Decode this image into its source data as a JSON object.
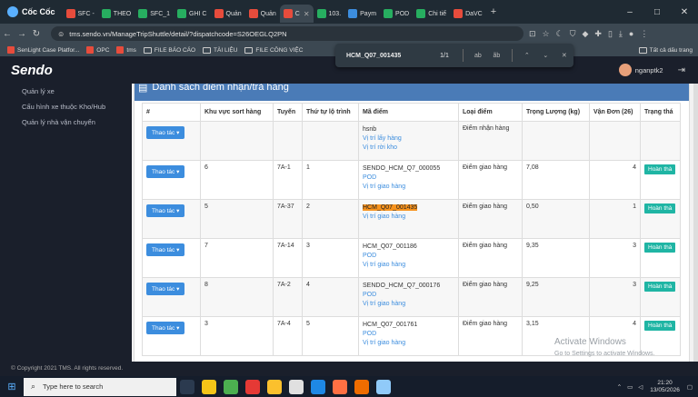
{
  "browser": {
    "brand": "Cốc Cốc",
    "tabs": [
      {
        "label": "SFC -",
        "color": "#e74c3c"
      },
      {
        "label": "THEO",
        "color": "#27ae60"
      },
      {
        "label": "SFC_1",
        "color": "#27ae60"
      },
      {
        "label": "GHI C",
        "color": "#27ae60"
      },
      {
        "label": "Quản",
        "color": "#e74c3c"
      },
      {
        "label": "Quản",
        "color": "#e74c3c"
      },
      {
        "label": "C",
        "color": "#e74c3c"
      },
      {
        "label": "103.",
        "color": "#27ae60"
      },
      {
        "label": "Paym",
        "color": "#3c8dde"
      },
      {
        "label": "POD",
        "color": "#27ae60"
      },
      {
        "label": "Chi tiế",
        "color": "#27ae60"
      },
      {
        "label": "DaVC",
        "color": "#e74c3c"
      }
    ],
    "active_tab_index": 6,
    "url": "tms.sendo.vn/ManageTripShuttle/detail/?dispatchcode=S26OEGLQ2PN",
    "bookmarks": [
      {
        "label": "SenLight Case Platfor...",
        "kind": "site",
        "color": "#e74c3c"
      },
      {
        "label": "OPC",
        "kind": "site",
        "color": "#e74c3c"
      },
      {
        "label": "tms",
        "kind": "site",
        "color": "#e74c3c"
      },
      {
        "label": "FILE BÁO CÁO",
        "kind": "folder"
      },
      {
        "label": "TÀI LIỆU",
        "kind": "folder"
      },
      {
        "label": "FILE CÔNG VIỆC",
        "kind": "folder"
      }
    ],
    "bookmarks_all": "Tất cả dấu trang",
    "find": {
      "query": "HCM_Q07_001435",
      "count": "1/1"
    }
  },
  "app": {
    "logo": "Sendo",
    "username": "nganptk2",
    "sidebar": [
      {
        "label": "Quản lý xe"
      },
      {
        "label": "Cấu hình xe thuộc Kho/Hub"
      },
      {
        "label": "Quản lý nhà vận chuyển"
      }
    ],
    "panel_title": "Danh sách điểm nhận/trả hàng",
    "columns": [
      "#",
      "Khu vực sort hàng",
      "Tuyến",
      "Thứ tự lộ trình",
      "Mã điểm",
      "Loại điểm",
      "Trọng Lượng (kg)",
      "Vận Đơn (26)",
      "Trạng thá"
    ],
    "action_label": "Thao tác",
    "rows": [
      {
        "area": "",
        "route": "",
        "order": "",
        "code": "hsnb",
        "links": [
          "Vị trí lấy hàng",
          "Vị trí rời kho"
        ],
        "type": "Điểm nhận hàng",
        "weight": "",
        "orders": "",
        "status": ""
      },
      {
        "area": "6",
        "route": "7A-1",
        "order": "1",
        "code": "SENDO_HCM_Q7_000055",
        "links": [
          "POD",
          "Vị trí giao hàng"
        ],
        "type": "Điểm giao hàng",
        "weight": "7,08",
        "orders": "4",
        "status": "Hoàn thà"
      },
      {
        "area": "5",
        "route": "7A-37",
        "order": "2",
        "code": "HCM_Q07_001435",
        "highlight": true,
        "links": [
          "Vị trí giao hàng"
        ],
        "type": "Điểm giao hàng",
        "weight": "0,50",
        "orders": "1",
        "status": "Hoàn thà"
      },
      {
        "area": "7",
        "route": "7A-14",
        "order": "3",
        "code": "HCM_Q07_001186",
        "links": [
          "POD",
          "Vị trí giao hàng"
        ],
        "type": "Điểm giao hàng",
        "weight": "9,35",
        "orders": "3",
        "status": "Hoàn thà"
      },
      {
        "area": "8",
        "route": "7A-2",
        "order": "4",
        "code": "SENDO_HCM_Q7_000176",
        "links": [
          "POD",
          "Vị trí giao hàng"
        ],
        "type": "Điểm giao hàng",
        "weight": "9,25",
        "orders": "3",
        "status": "Hoàn thà"
      },
      {
        "area": "3",
        "route": "7A-4",
        "order": "5",
        "code": "HCM_Q07_001761",
        "links": [
          "POD",
          "Vị trí giao hàng"
        ],
        "type": "Điểm giao hàng",
        "weight": "3,15",
        "orders": "4",
        "status": "Hoàn thà"
      }
    ],
    "footer": "© Copyright 2021 TMS. All rights reserved."
  },
  "watermark": {
    "title": "Activate Windows",
    "sub": "Go to Settings to activate Windows."
  },
  "taskbar": {
    "search_placeholder": "Type here to search",
    "time": "21:20",
    "date": "13/05/2026"
  }
}
